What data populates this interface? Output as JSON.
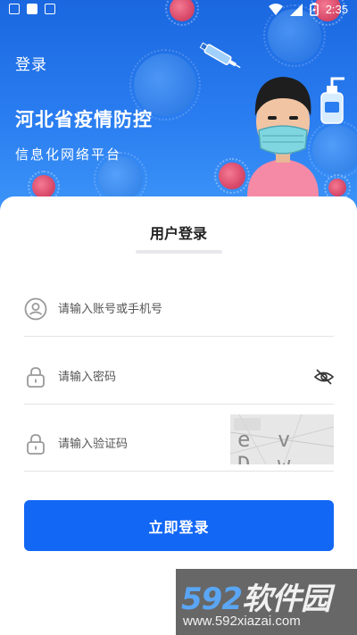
{
  "status_bar": {
    "time": "2:35"
  },
  "header": {
    "page_label": "登录",
    "app_title": "河北省疫情防控",
    "app_subtitle": "信息化网络平台"
  },
  "login": {
    "title": "用户登录",
    "account": {
      "placeholder": "请输入账号或手机号",
      "value": ""
    },
    "password": {
      "placeholder": "请输入密码",
      "value": ""
    },
    "captcha": {
      "placeholder": "请输入验证码",
      "value": "",
      "image_text": "evDw"
    },
    "submit_label": "立即登录"
  },
  "watermark": {
    "logo_digits": "592",
    "logo_text": "软件园",
    "url": "www.592xiazai.com"
  },
  "colors": {
    "primary": "#1367f5",
    "banner": "#2a7df0"
  }
}
